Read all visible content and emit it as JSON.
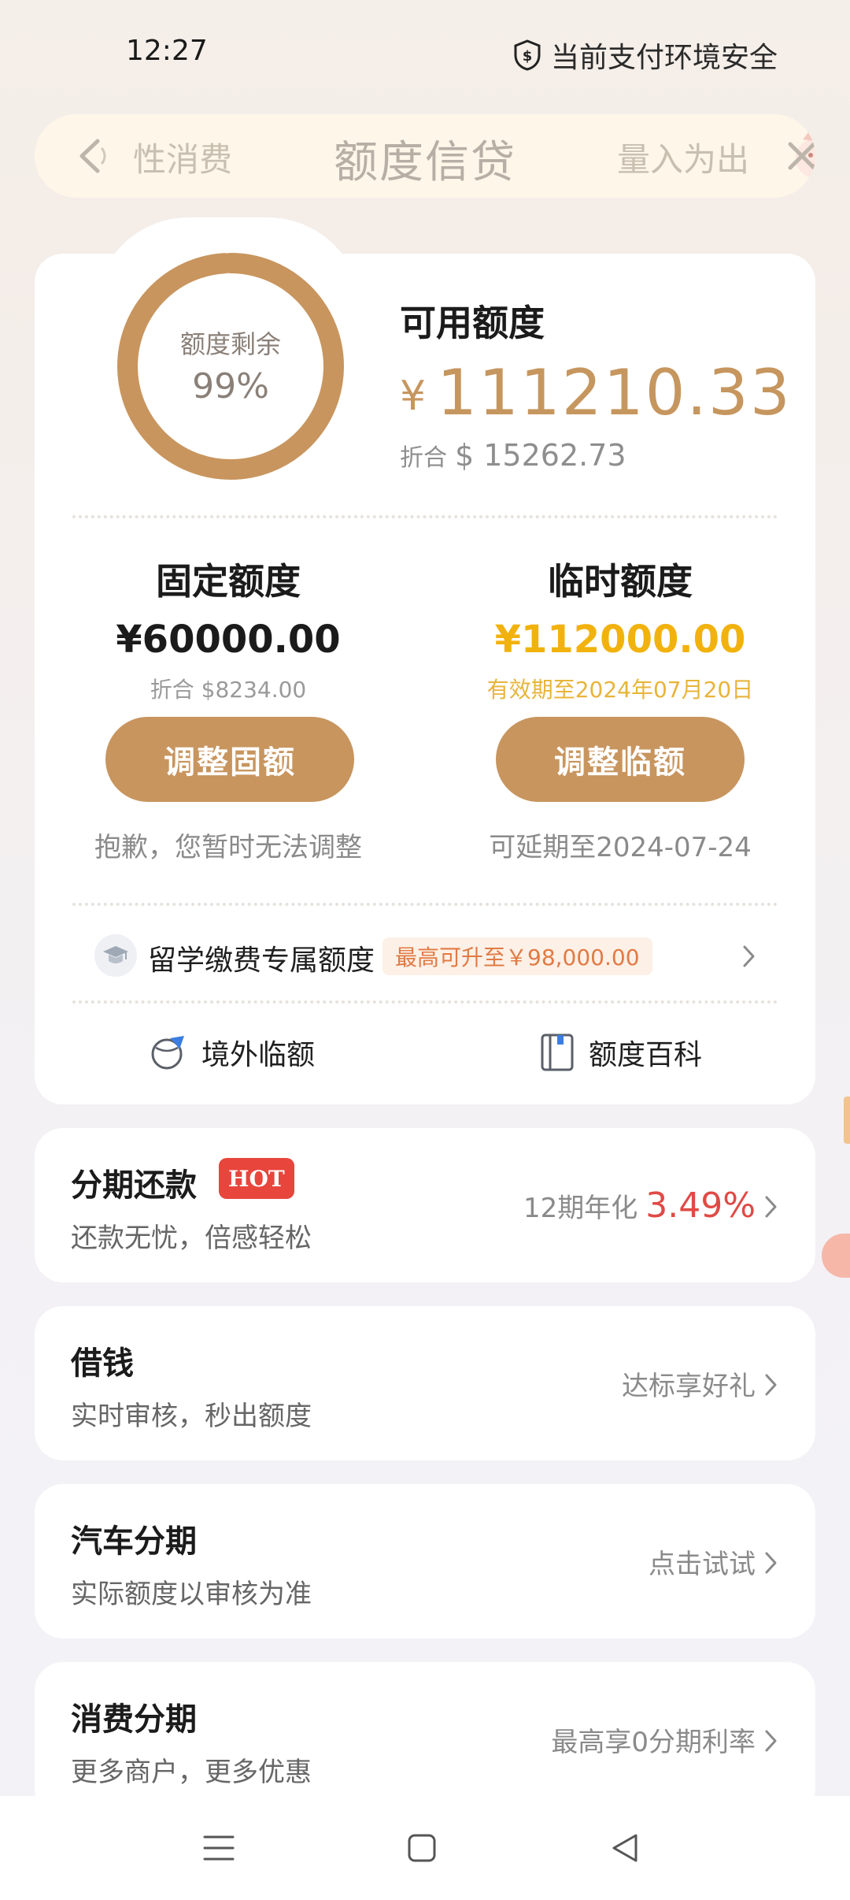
{
  "status_bar": {
    "time": "12:27",
    "security_text": "当前支付环境安全"
  },
  "header": {
    "title": "额度信贷",
    "marquee_left": "性消费",
    "marquee_right": "量入为出"
  },
  "quota": {
    "ring_label": "额度剩余",
    "ring_percent": "99%",
    "ring_fraction": 0.99,
    "available_label": "可用额度",
    "available_currency": "¥",
    "available_amount": "111210.33",
    "converted_label": "折合",
    "converted_amount": "$ 15262.73"
  },
  "fixed": {
    "title": "固定额度",
    "amount": "¥60000.00",
    "sub": "折合 $8234.00",
    "button": "调整固额",
    "note": "抱歉，您暂时无法调整"
  },
  "temporary": {
    "title": "临时额度",
    "amount": "¥112000.00",
    "sub": "有效期至2024年07月20日",
    "button": "调整临额",
    "note": "可延期至2024-07-24"
  },
  "study": {
    "label": "留学缴费专属额度",
    "tag": "最高可升至￥98,000.00"
  },
  "tools": {
    "overseas": "境外临额",
    "encyclopedia": "额度百科"
  },
  "features": [
    {
      "title": "分期还款",
      "badge": "HOT",
      "sub": "还款无忧，倍感轻松",
      "right_text": "12期年化",
      "rate": "3.49%"
    },
    {
      "title": "借钱",
      "sub": "实时审核，秒出额度",
      "right_text": "达标享好礼"
    },
    {
      "title": "汽车分期",
      "sub": "实际额度以审核为准",
      "right_text": "点击试试"
    },
    {
      "title": "消费分期",
      "sub": "更多商户，更多优惠",
      "right_text": "最高享0分期利率"
    }
  ],
  "colors": {
    "accent_gold": "#c8955e",
    "temp_amount": "#f2b20e",
    "temp_sub": "#e8b43a",
    "rate_red": "#e04a45",
    "hot_red": "#e8453c"
  },
  "icons": {
    "status": "shield-dollar-icon",
    "back": "back-arrow-icon",
    "close": "close-icon",
    "study": "graduation-cap-icon",
    "overseas": "globe-plane-icon",
    "encyclopedia": "book-icon",
    "nav": [
      "menu-icon",
      "home-square-icon",
      "back-triangle-icon"
    ]
  }
}
